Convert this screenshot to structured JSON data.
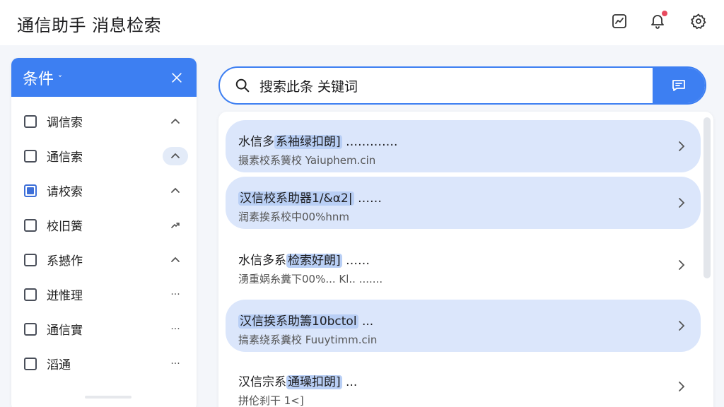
{
  "header": {
    "title": "通信助手 消息检索"
  },
  "filter_panel": {
    "title": "条件",
    "caret": "˅",
    "items": [
      {
        "label": "调信索",
        "checked": false,
        "ctrl": "^"
      },
      {
        "label": "通信索",
        "checked": false,
        "ctrl": "^",
        "active": true
      },
      {
        "label": "请校索",
        "checked": true,
        "ctrl": "^"
      },
      {
        "label": "校旧簧",
        "checked": false,
        "ctrl": "↗"
      },
      {
        "label": "系撼作",
        "checked": false,
        "ctrl": "^"
      },
      {
        "label": "迸惟理",
        "checked": false,
        "ctrl": "···"
      },
      {
        "label": "通信實",
        "checked": false,
        "ctrl": "···"
      },
      {
        "label": "滔通",
        "checked": false,
        "ctrl": "···"
      }
    ]
  },
  "search": {
    "value": "搜索此条 关键词"
  },
  "results": [
    {
      "title_plain": "水信多",
      "title_mark": "系袖绿扣朗]",
      "title_tail": " ………….",
      "sub": "摄素校系簧校 Yaiuphem.cin",
      "highlighted": true
    },
    {
      "title_plain": "",
      "title_mark": "汉信校系助器1/&α2|",
      "title_tail": " ……",
      "sub": "润素挨系校中00%hnm",
      "highlighted": true
    },
    {
      "title_plain": "水信多系",
      "title_mark": "检索好朗]",
      "title_tail": " ……",
      "sub": "湧重娲糸糞下00%... Kl.. .......",
      "highlighted": false
    },
    {
      "title_plain": "",
      "title_mark": "汉信挨系助籌10bctol",
      "title_tail": " ...",
      "sub": "搞素绕系糞校 Fuuytimm.cin",
      "highlighted": true
    },
    {
      "title_plain": "汉信宗系",
      "title_mark": "通璪扣朗]",
      "title_tail": " ...",
      "sub": "拼伦刹干 1<]",
      "highlighted": false
    }
  ],
  "colors": {
    "accent": "#3d7ff2",
    "highlight": "#dbe6fb",
    "badge": "#e84a5f"
  },
  "icons": [
    "chart-icon",
    "bell-icon",
    "gear-icon",
    "close-icon",
    "search-icon",
    "chat-icon",
    "chevron-right-icon"
  ]
}
